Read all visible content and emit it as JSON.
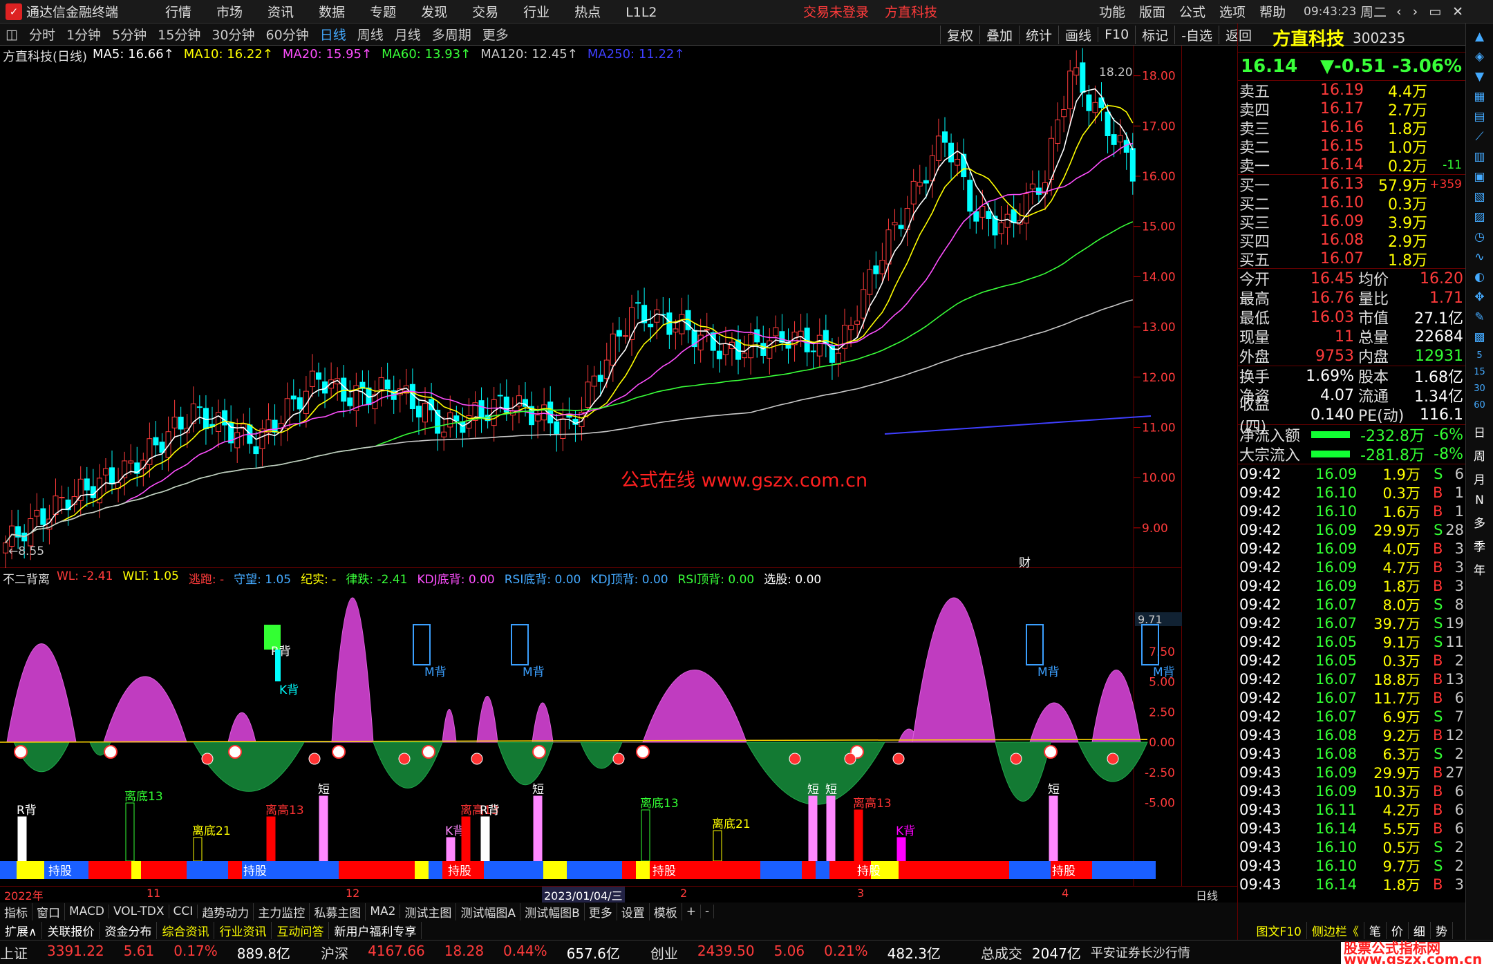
{
  "titlebar": {
    "app": "通达信金融终端",
    "menu": [
      "行情",
      "市场",
      "资讯",
      "数据",
      "专题",
      "发现",
      "交易",
      "行业",
      "热点",
      "L1L2"
    ],
    "login": "交易未登录",
    "stock": "方直科技",
    "right_menu": [
      "功能",
      "版面",
      "公式",
      "选项",
      "帮助"
    ],
    "time": "09:43:23",
    "weekday": "周二"
  },
  "periods": [
    "分时",
    "1分钟",
    "5分钟",
    "15分钟",
    "30分钟",
    "60分钟",
    "日线",
    "周线",
    "月线",
    "多周期",
    "更多"
  ],
  "active_period": "日线",
  "tools": [
    "复权",
    "叠加",
    "统计",
    "画线",
    "F10",
    "标记",
    "-自选",
    "返回"
  ],
  "main": {
    "label": "方直科技(日线)",
    "ma": [
      {
        "t": "MA5: 16.66",
        "c": "#ffffff"
      },
      {
        "t": "MA10: 16.22",
        "c": "#ffff00"
      },
      {
        "t": "MA20: 15.95",
        "c": "#ff4fff"
      },
      {
        "t": "MA60: 13.93",
        "c": "#39ff39"
      },
      {
        "t": "MA120: 12.45",
        "c": "#c8c8c8"
      },
      {
        "t": "MA250: 11.22",
        "c": "#3f3fff"
      }
    ],
    "high": "18.20",
    "low": "8.55",
    "watermark": "公式在线  www.gszx.com.cn",
    "yticks": [
      "18.00",
      "17.00",
      "16.00",
      "15.00",
      "14.00",
      "13.00",
      "12.00",
      "11.00",
      "10.00",
      "9.00"
    ],
    "marker": "财"
  },
  "indicator": {
    "name": "不二背离",
    "items": [
      {
        "t": "WL: -2.41",
        "c": "#ff3b3b"
      },
      {
        "t": "WLT: 1.05",
        "c": "#ffff00"
      },
      {
        "t": "逃跑: -",
        "c": "#ff3b3b"
      },
      {
        "t": "守望: 1.05",
        "c": "#4af"
      },
      {
        "t": "纪实: -",
        "c": "#ffff00"
      },
      {
        "t": "律跌: -2.41",
        "c": "#39ff39"
      },
      {
        "t": "KDJ底背: 0.00",
        "c": "#ff4fff"
      },
      {
        "t": "RSI底背: 0.00",
        "c": "#4af"
      },
      {
        "t": "KDJ顶背: 0.00",
        "c": "#4af"
      },
      {
        "t": "RSI顶背: 0.00",
        "c": "#39ff39"
      },
      {
        "t": "选股: 0.00",
        "c": "#ffffff"
      }
    ],
    "yticks": [
      "7.50",
      "5.00",
      "2.50",
      "0.00",
      "-2.50",
      "-5.00"
    ],
    "top": "9.71",
    "labels": [
      "R背",
      "K背",
      "M背",
      "M背",
      "M背",
      "M背",
      "离底13",
      "离底21",
      "离高13",
      "离高13",
      "离高13",
      "R背",
      "K背",
      "K背",
      "短",
      "短",
      "短",
      "短",
      "持股",
      "持股",
      "持股",
      "持股",
      "持股"
    ]
  },
  "dates": [
    "2022年",
    "11",
    "12",
    "2023/01/04/三",
    "2",
    "3",
    "4",
    "日线"
  ],
  "tabs1": [
    "指标",
    "窗口",
    "MACD",
    "VOL-TDX",
    "CCI",
    "趋势动力",
    "主力监控",
    "私募主图",
    "MA2",
    "测试主图",
    "测试幅图A",
    "测试幅图B",
    "更多",
    "设置",
    "模板",
    "+",
    "-"
  ],
  "tabs2": [
    "扩展∧",
    "关联报价",
    "资金分布",
    "综合资讯",
    "行业资讯",
    "互动问答",
    "新用户福利专享",
    "图文F10",
    "侧边栏《",
    "笔",
    "价",
    "细",
    "势"
  ],
  "indexbar": [
    {
      "n": "上证",
      "v": "3391.22",
      "c": "5.61",
      "p": "0.17%",
      "a": "889.8亿"
    },
    {
      "n": "沪深",
      "v": "4167.66",
      "c": "18.28",
      "p": "0.44%",
      "a": "657.6亿"
    },
    {
      "n": "创业",
      "v": "2439.50",
      "c": "5.06",
      "p": "0.21%",
      "a": "482.3亿"
    }
  ],
  "total": {
    "label": "总成交",
    "value": "2047亿",
    "broker": "平安证券长沙行情"
  },
  "logo_text": "股票公式指标网 www.gszx.com.cn",
  "quote": {
    "name": "方直科技",
    "code": "300235",
    "price": "16.14",
    "chg": "▼-0.51",
    "pct": "-3.06%",
    "sell": [
      [
        "卖五",
        "16.19",
        "4.4万",
        ""
      ],
      [
        "卖四",
        "16.17",
        "2.7万",
        ""
      ],
      [
        "卖三",
        "16.16",
        "1.8万",
        ""
      ],
      [
        "卖二",
        "16.15",
        "1.0万",
        ""
      ],
      [
        "卖一",
        "16.14",
        "0.2万",
        "-11"
      ]
    ],
    "buy": [
      [
        "买一",
        "16.13",
        "57.9万",
        "+359"
      ],
      [
        "买二",
        "16.10",
        "0.3万",
        ""
      ],
      [
        "买三",
        "16.09",
        "3.9万",
        ""
      ],
      [
        "买四",
        "16.08",
        "2.9万",
        ""
      ],
      [
        "买五",
        "16.07",
        "1.8万",
        ""
      ]
    ],
    "stats": [
      [
        "今开",
        "16.45",
        "均价",
        "16.20"
      ],
      [
        "最高",
        "16.76",
        "量比",
        "1.71"
      ],
      [
        "最低",
        "16.03",
        "市值",
        "27.1亿"
      ],
      [
        "现量",
        "11",
        "总量",
        "22684"
      ],
      [
        "外盘",
        "9753",
        "内盘",
        "12931"
      ],
      [
        "换手",
        "1.69%",
        "股本",
        "1.68亿"
      ],
      [
        "净资",
        "4.07",
        "流通",
        "1.34亿"
      ],
      [
        "收益(四)",
        "0.140",
        "PE(动)",
        "116.1"
      ]
    ],
    "flow": [
      [
        "净流入额",
        "-232.8万",
        "-6%"
      ],
      [
        "大宗流入",
        "-281.8万",
        "-8%"
      ]
    ],
    "ticks": [
      [
        "09:42",
        "16.09",
        "1.9万",
        "S",
        "6"
      ],
      [
        "09:42",
        "16.10",
        "0.3万",
        "B",
        "1"
      ],
      [
        "09:42",
        "16.10",
        "1.6万",
        "B",
        "1"
      ],
      [
        "09:42",
        "16.09",
        "29.9万",
        "S",
        "28"
      ],
      [
        "09:42",
        "16.09",
        "4.0万",
        "B",
        "3"
      ],
      [
        "09:42",
        "16.09",
        "4.7万",
        "B",
        "3"
      ],
      [
        "09:42",
        "16.09",
        "1.8万",
        "B",
        "3"
      ],
      [
        "09:42",
        "16.07",
        "8.0万",
        "S",
        "8"
      ],
      [
        "09:42",
        "16.07",
        "39.7万",
        "S",
        "19"
      ],
      [
        "09:42",
        "16.05",
        "9.1万",
        "S",
        "11"
      ],
      [
        "09:42",
        "16.05",
        "0.3万",
        "B",
        "2"
      ],
      [
        "09:42",
        "16.07",
        "18.8万",
        "B",
        "13"
      ],
      [
        "09:42",
        "16.07",
        "11.7万",
        "B",
        "6"
      ],
      [
        "09:42",
        "16.07",
        "6.9万",
        "S",
        "7"
      ],
      [
        "09:43",
        "16.08",
        "9.2万",
        "B",
        "12"
      ],
      [
        "09:43",
        "16.08",
        "6.3万",
        "S",
        "2"
      ],
      [
        "09:43",
        "16.09",
        "29.9万",
        "B",
        "27"
      ],
      [
        "09:43",
        "16.09",
        "10.3万",
        "B",
        "6"
      ],
      [
        "09:43",
        "16.11",
        "4.2万",
        "B",
        "6"
      ],
      [
        "09:43",
        "16.14",
        "5.5万",
        "B",
        "6"
      ],
      [
        "09:43",
        "16.10",
        "0.5万",
        "S",
        "2"
      ],
      [
        "09:43",
        "16.10",
        "9.7万",
        "S",
        "2"
      ],
      [
        "09:43",
        "16.14",
        "1.8万",
        "B",
        "3"
      ]
    ]
  },
  "sideicons": [
    "日",
    "周",
    "月",
    "N",
    "多",
    "季",
    "年"
  ]
}
